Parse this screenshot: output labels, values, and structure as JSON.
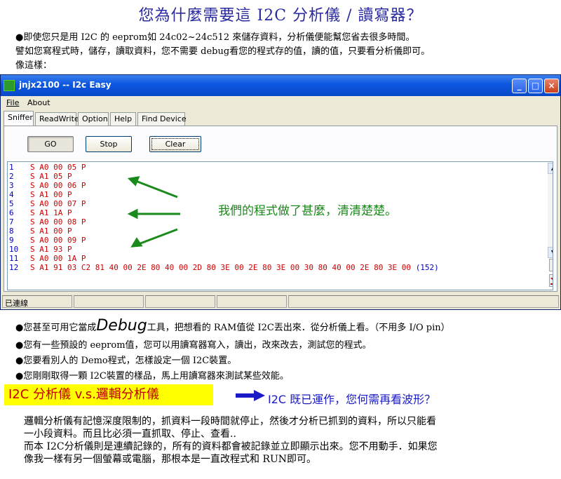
{
  "heading": "您為什麼需要這 I2C 分析儀 / 讀寫器？",
  "intro": [
    "●即使您只是用 I2C 的 eeprom如 24c02~24c512 來儲存資料，分析儀便能幫您省去很多時間。",
    "譬如您寫程式時，儲存，讀取資料，您不需要 debug看您的程式存的值，讀的值，只要看分析儀即可。",
    "像這樣："
  ],
  "window": {
    "title": "jnjx2100 -- I2c Easy",
    "controls": {
      "minimize": "_",
      "maximize": "□",
      "close": "×"
    },
    "menu": [
      "File",
      "About"
    ],
    "tabs": [
      "Sniffer",
      "ReadWrite",
      "Option",
      "Help",
      "Find Device"
    ],
    "buttons": {
      "go": "GO",
      "stop": "Stop",
      "clear": "Clear"
    },
    "log_rows": [
      {
        "n": "1",
        "d": "S A0 00 05 P"
      },
      {
        "n": "2",
        "d": "S A1 05 P"
      },
      {
        "n": "3",
        "d": "S A0 00 06 P"
      },
      {
        "n": "4",
        "d": "S A1 00 P"
      },
      {
        "n": "5",
        "d": "S A0 00 07 P"
      },
      {
        "n": "6",
        "d": "S A1 1A P"
      },
      {
        "n": "7",
        "d": "S A0 00 08 P"
      },
      {
        "n": "8",
        "d": "S A1 00 P"
      },
      {
        "n": "9",
        "d": "S A0 00 09 P"
      },
      {
        "n": "10",
        "d": "S A1 93 P"
      },
      {
        "n": "11",
        "d": "S A0 00 1A P"
      },
      {
        "n": "12",
        "d": "S A1 91 03 C2 81 40 00 2E 80 40 00 2D 80 3E 00 2E 80 3E 00 30 80 40 00 2E 80 3E 00",
        "c": "(152)"
      }
    ],
    "annotation": "我們的程式做了甚麼，清清楚楚。",
    "side_buttons": {
      "n": "N"
    },
    "status": "已連線",
    "colors": {
      "hex_data": "#d00000",
      "row_number": "#0000c0",
      "annotation": "#1a8a1a"
    }
  },
  "bullets": {
    "b1_pre": "●您甚至可用它當成",
    "b1_word": "Debug",
    "b1_post": "工具，把想看的 RAM值從 I2C丟出來．從分析儀上看。（不用多 I/O pin）",
    "b2": "●您有一些預設的 eeprom值，您可以用讀寫器寫入，讀出，改來改去，測試您的程式。",
    "b3": "●您要看別人的 Demo程式，怎樣設定一個 I2C裝置。",
    "b4": "●您剛剛取得一顆 I2C裝置的樣品，馬上用讀寫器來測試某些效能。"
  },
  "comparison": {
    "badge": "I2C 分析儀 v.s.邏輯分析儀",
    "question": "I2C 既已運作，您何需再看波形？",
    "colors": {
      "badge_bg": "#ffff00",
      "badge_text": "#c00000",
      "question": "#1a1ac8"
    }
  },
  "paragraph": [
    "邏輯分析儀有記憶深度限制的，抓資料一段時間就停止，然後才分析已抓到的資料，所以只能看",
    "一小段資料。而且比必須一直抓取、停止、查看..",
    "而本 I2C分析儀則是連續記錄的，所有的資料都會被記錄並立即顯示出來。您不用動手．如果您",
    "像我一樣有另一個螢幕或電腦，那根本是一直改程式和 RUN即可。"
  ]
}
